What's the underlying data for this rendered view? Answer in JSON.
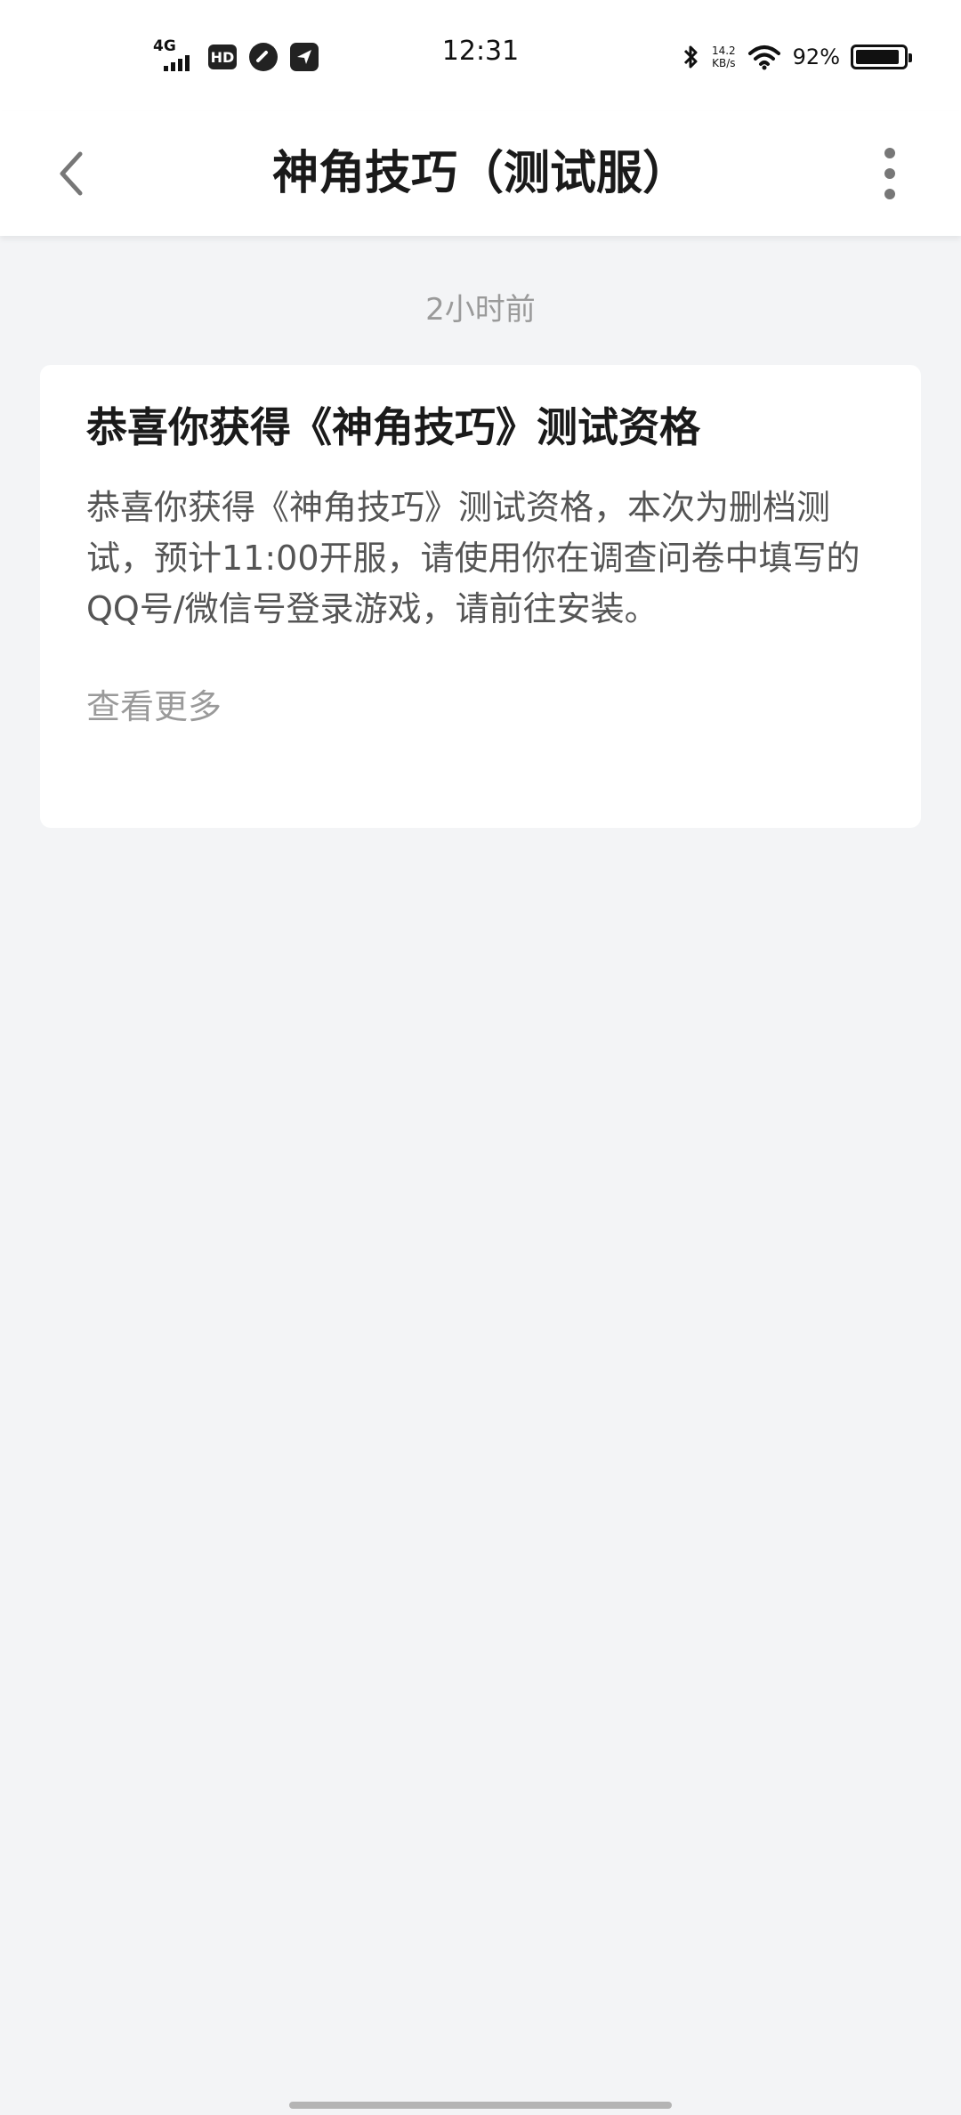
{
  "status_bar": {
    "network": "4G",
    "hd": "HD",
    "time": "12:31",
    "speed_value": "14.2",
    "speed_unit": "KB/s",
    "battery_pct": "92%",
    "battery_level": 0.92
  },
  "app_bar": {
    "title": "神角技巧（测试服）",
    "back_icon": "chevron-left-icon",
    "more_icon": "more-vertical-icon"
  },
  "message": {
    "timestamp": "2小时前",
    "title": "恭喜你获得《神角技巧》测试资格",
    "body": "恭喜你获得《神角技巧》测试资格，本次为删档测试，预计11:00开服，请使用你在调查问卷中填写的QQ号/微信号登录游戏，请前往安装。",
    "more_label": "查看更多"
  },
  "colors": {
    "background": "#f3f4f6",
    "card": "#ffffff",
    "title_text": "#1a1a1a",
    "body_text": "#555555",
    "muted_text": "#9a9a9a"
  }
}
